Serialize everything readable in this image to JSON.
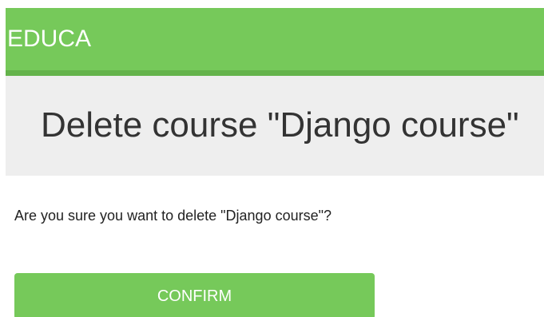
{
  "header": {
    "logo_text": "EDUCA"
  },
  "main": {
    "title": "Delete course \"Django course\"",
    "confirm_question": "Are you sure you want to delete \"Django course\"?",
    "confirm_button_label": "CONFIRM"
  },
  "colors": {
    "brand_green": "#76c95a",
    "header_border": "#64b34b",
    "title_band": "#eeeeee"
  }
}
